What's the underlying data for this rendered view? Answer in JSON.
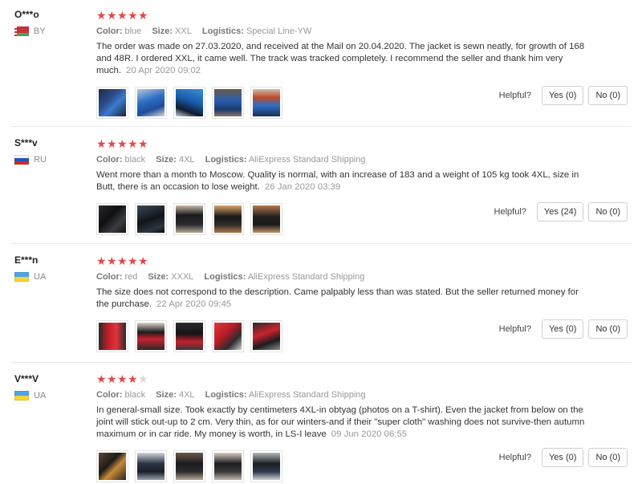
{
  "reviews": [
    {
      "buyer": "O***o",
      "country": "BY",
      "stars_filled": 5,
      "rating": 5,
      "attrs": {
        "color_label": "Color:",
        "color": "blue",
        "size_label": "Size:",
        "size": "XXL",
        "logistics_label": "Logistics:",
        "logistics": "Special Line-YW"
      },
      "text": "The order was made on 27.03.2020, and received at the Mail on 20.04.2020. The jacket is sewn neatly, for growth of 168 and 48R. I ordered XXL, it came well. The track was tracked completely. I recommend the seller and thank him very much.",
      "date": "20 Apr 2020 09:02",
      "helpful_label": "Helpful?",
      "yes_label": "Yes (0)",
      "no_label": "No (0)",
      "photos": [
        "p-blue1",
        "p-blue2",
        "p-blue3",
        "p-blue4",
        "p-blue5"
      ]
    },
    {
      "buyer": "S***v",
      "country": "RU",
      "rating": 5,
      "attrs": {
        "color_label": "Color:",
        "color": "black",
        "size_label": "Size:",
        "size": "4XL",
        "logistics_label": "Logistics:",
        "logistics": "AliExpress Standard Shipping"
      },
      "text": "Went more than a month to Moscow. Quality is normal, with an increase of 183 and a weight of 105 kg took 4XL, size in Butt, there is an occasion to lose weight.",
      "date": "26 Jan 2020 03:39",
      "helpful_label": "Helpful?",
      "yes_label": "Yes (24)",
      "no_label": "No (0)",
      "photos": [
        "p-black1",
        "p-black2",
        "p-black3",
        "p-black4",
        "p-black5"
      ]
    },
    {
      "buyer": "E***n",
      "country": "UA",
      "rating": 5,
      "attrs": {
        "color_label": "Color:",
        "color": "red",
        "size_label": "Size:",
        "size": "XXXL",
        "logistics_label": "Logistics:",
        "logistics": "AliExpress Standard Shipping"
      },
      "text": "The size does not correspond to the description. Came palpably less than was stated. But the seller returned money for the purchase.",
      "date": "22 Apr 2020 09:45",
      "helpful_label": "Helpful?",
      "yes_label": "Yes (0)",
      "no_label": "No (0)",
      "photos": [
        "p-red1",
        "p-red2",
        "p-red3",
        "p-red4",
        "p-red5"
      ]
    },
    {
      "buyer": "V***V",
      "country": "UA",
      "rating": 4,
      "attrs": {
        "color_label": "Color:",
        "color": "black",
        "size_label": "Size:",
        "size": "4XL",
        "logistics_label": "Logistics:",
        "logistics": "AliExpress Standard Shipping"
      },
      "text": "In general-small size. Took exactly by centimeters 4XL-in obtyag (photos on a T-shirt). Even the jacket from below on the joint will stick out-up to 2 cm. Very thin, as for our winters-and if their \"super cloth\" washing does not survive-then autumn maximum or in car ride. My money is worth, in LS-I leave",
      "date": "09 Jun 2020 06:55",
      "helpful_label": "Helpful?",
      "yes_label": "Yes (0)",
      "no_label": "No (0)",
      "photos": [
        "p-v1",
        "p-v2",
        "p-v3",
        "p-v4",
        "p-v5"
      ]
    }
  ],
  "colors": {
    "star_on": "#e1484c",
    "star_off": "#d7d7d7"
  }
}
